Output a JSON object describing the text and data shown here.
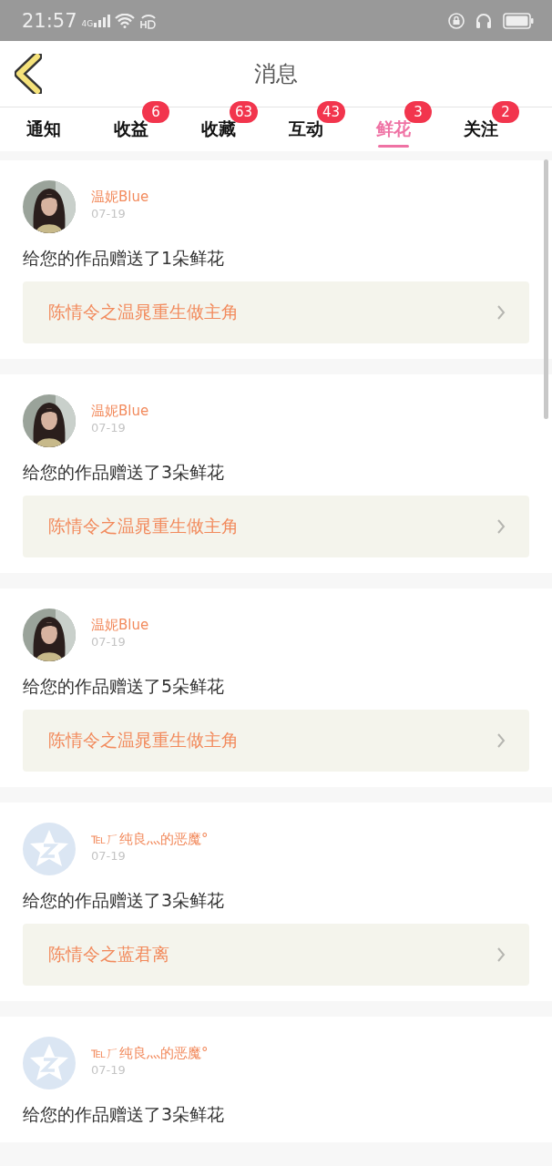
{
  "status_bar": {
    "time": "21:57",
    "network": "4G"
  },
  "header": {
    "title": "消息"
  },
  "tabs": [
    {
      "label": "通知",
      "selected": false
    },
    {
      "label": "收益",
      "badge": "6",
      "selected": false
    },
    {
      "label": "收藏",
      "badge": "63",
      "selected": false
    },
    {
      "label": "互动",
      "badge": "43",
      "selected": false
    },
    {
      "label": "鲜花",
      "badge": "3",
      "selected": true
    },
    {
      "label": "关注",
      "badge": "2",
      "selected": false
    }
  ],
  "messages": [
    {
      "name": "温妮Blue",
      "date": "07-19",
      "text": "给您的作品赠送了1朵鲜花",
      "link": "陈情令之温晁重生做主角"
    },
    {
      "name": "温妮Blue",
      "date": "07-19",
      "text": "给您的作品赠送了3朵鲜花",
      "link": "陈情令之温晁重生做主角"
    },
    {
      "name": "温妮Blue",
      "date": "07-19",
      "text": "给您的作品赠送了5朵鲜花",
      "link": "陈情令之温晁重生做主角"
    },
    {
      "avatar": {
        "kind": "default"
      },
      "name": "℡ㄏ纯良灬的恶魔°",
      "date": "07-19",
      "text": "给您的作品赠送了3朵鲜花",
      "link": "陈情令之蓝君离"
    },
    {
      "avatar": {
        "kind": "default"
      },
      "name": "℡ㄏ纯良灬的恶魔°",
      "date": "07-19",
      "text": "给您的作品赠送了3朵鲜花"
    }
  ]
}
